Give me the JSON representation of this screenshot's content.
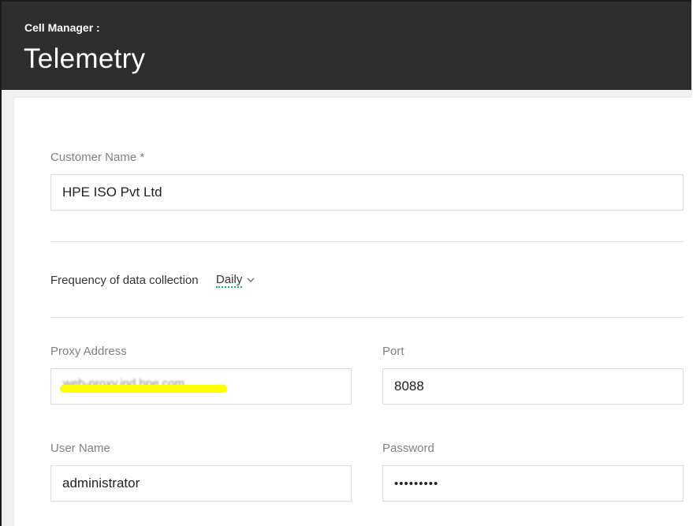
{
  "header": {
    "breadcrumb": "Cell Manager :",
    "title": "Telemetry"
  },
  "form": {
    "customer_name": {
      "label": "Customer Name *",
      "value": "HPE ISO Pvt Ltd"
    },
    "frequency": {
      "label": "Frequency of data collection",
      "value": "Daily"
    },
    "proxy_address": {
      "label": "Proxy Address",
      "value": "web-proxy.ind.hpe.com"
    },
    "port": {
      "label": "Port",
      "value": "8088"
    },
    "user_name": {
      "label": "User Name",
      "value": "administrator"
    },
    "password": {
      "label": "Password",
      "value": "•••••••••"
    }
  },
  "colors": {
    "header_bg": "#2d2d2d",
    "redaction_highlight": "#ffff00",
    "select_underline": "#2aa37a"
  },
  "icons": {
    "frequency_dropdown": "chevron-down-icon"
  }
}
